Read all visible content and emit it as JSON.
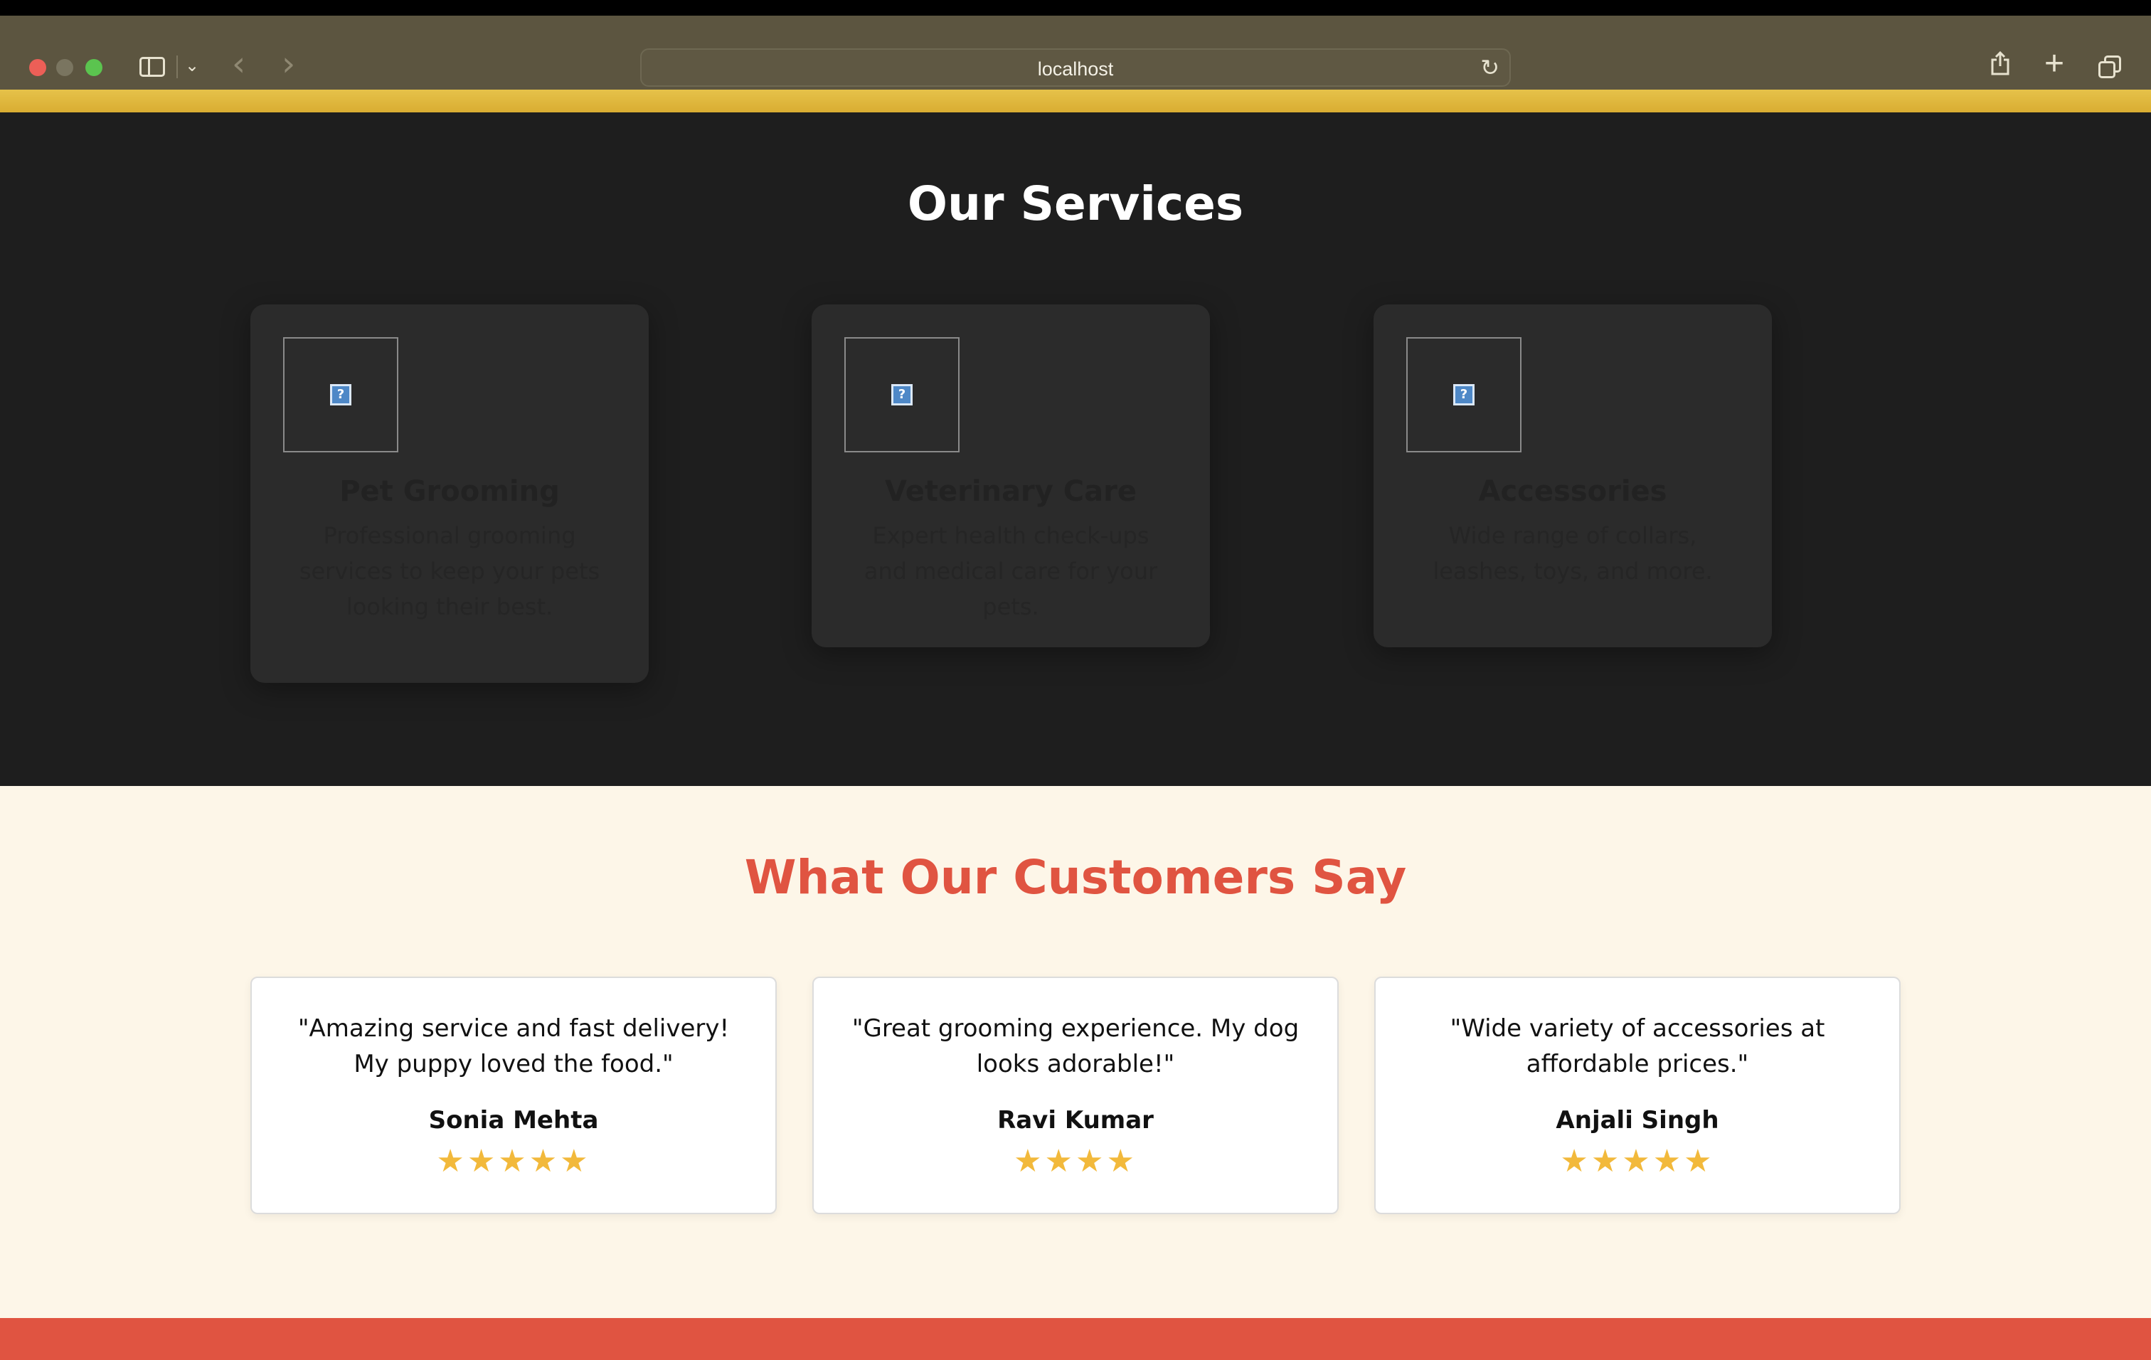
{
  "browser": {
    "url": "localhost"
  },
  "services": {
    "title": "Our Services",
    "cards": [
      {
        "title": "Pet Grooming",
        "description": "Professional grooming services to keep your pets looking their best."
      },
      {
        "title": "Veterinary Care",
        "description": "Expert health check-ups and medical care for your pets."
      },
      {
        "title": "Accessories",
        "description": "Wide range of collars, leashes, toys, and more."
      }
    ]
  },
  "testimonials": {
    "title": "What Our Customers Say",
    "items": [
      {
        "quote": "\"Amazing service and fast delivery! My puppy loved the food.\"",
        "author": "Sonia Mehta",
        "rating": 5,
        "stars": "★★★★★"
      },
      {
        "quote": "\"Great grooming experience. My dog looks adorable!\"",
        "author": "Ravi Kumar",
        "rating": 4,
        "stars": "★★★★"
      },
      {
        "quote": "\"Wide variety of accessories at affordable prices.\"",
        "author": "Anjali Singh",
        "rating": 5,
        "stars": "★★★★★"
      }
    ]
  },
  "colors": {
    "accent_red": "#e05441",
    "accent_yellow": "#e6c24a",
    "star": "#f2b93b",
    "dark_bg": "#1e1e1e",
    "cream_bg": "#fdf6e8"
  }
}
